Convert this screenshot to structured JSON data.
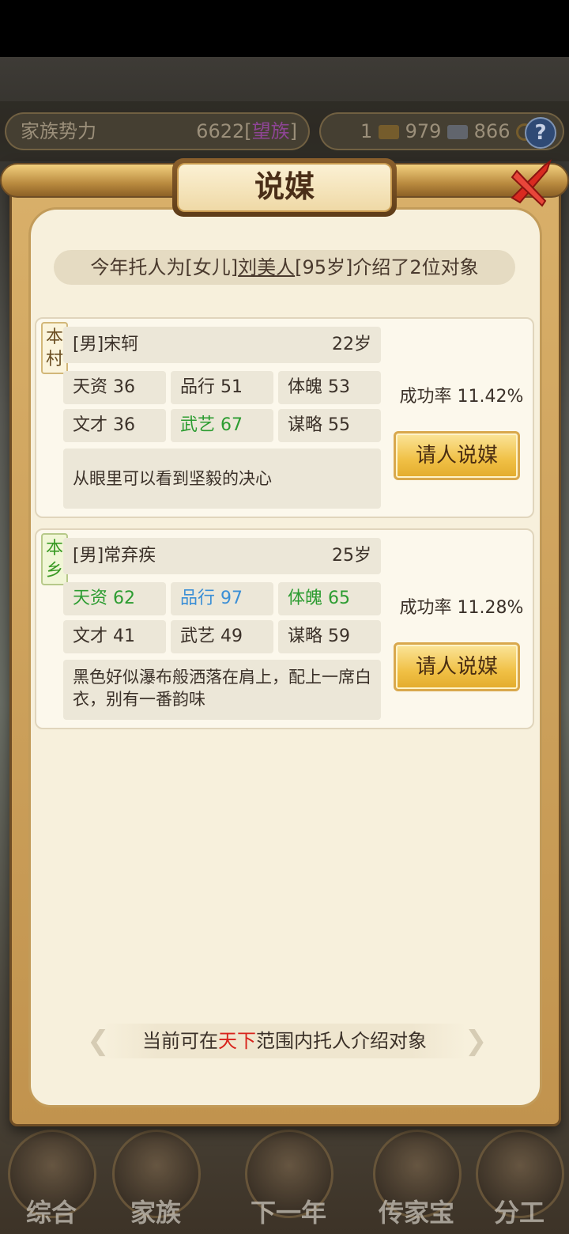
{
  "background": {
    "family_power_label": "家族势力",
    "family_power_value": "6622",
    "family_power_rank": "望族",
    "resource_1": "1",
    "resource_2": "979",
    "resource_3": "866",
    "help": "?"
  },
  "dialog": {
    "title": "说媒",
    "intro": {
      "prefix": "今年托人为[女儿]",
      "name": "刘美人",
      "suffix": "[95岁]介绍了2位对象"
    },
    "candidates": [
      {
        "tag": "本村",
        "name": "[男]宋轲",
        "age": "22岁",
        "stats": [
          {
            "label": "天资 36",
            "color": "normal"
          },
          {
            "label": "品行 51",
            "color": "normal"
          },
          {
            "label": "体魄 53",
            "color": "normal"
          },
          {
            "label": "文才 36",
            "color": "normal"
          },
          {
            "label": "武艺 67",
            "color": "green"
          },
          {
            "label": "谋略 55",
            "color": "normal"
          }
        ],
        "description": "从眼里可以看到坚毅的决心",
        "success_rate": "成功率 11.42%",
        "button": "请人说媒"
      },
      {
        "tag": "本乡",
        "name": "[男]常弃疾",
        "age": "25岁",
        "stats": [
          {
            "label": "天资 62",
            "color": "green"
          },
          {
            "label": "品行 97",
            "color": "blue"
          },
          {
            "label": "体魄 65",
            "color": "green"
          },
          {
            "label": "文才 41",
            "color": "normal"
          },
          {
            "label": "武艺 49",
            "color": "normal"
          },
          {
            "label": "谋略 59",
            "color": "normal"
          }
        ],
        "description": "黑色好似瀑布般洒落在肩上，配上一席白衣，别有一番韵味",
        "success_rate": "成功率 11.28%",
        "button": "请人说媒"
      }
    ],
    "footer": {
      "prefix": "当前可在",
      "highlight": "天下",
      "suffix": "范围内托人介绍对象"
    }
  },
  "bottom_nav": [
    "综合",
    "家族",
    "下一年",
    "传家宝",
    "分工"
  ],
  "colors": {
    "green_stat": "#2c9c31",
    "blue_stat": "#3b8fd6",
    "highlight_red": "#d8231c",
    "button_gold": "#f0c045"
  }
}
